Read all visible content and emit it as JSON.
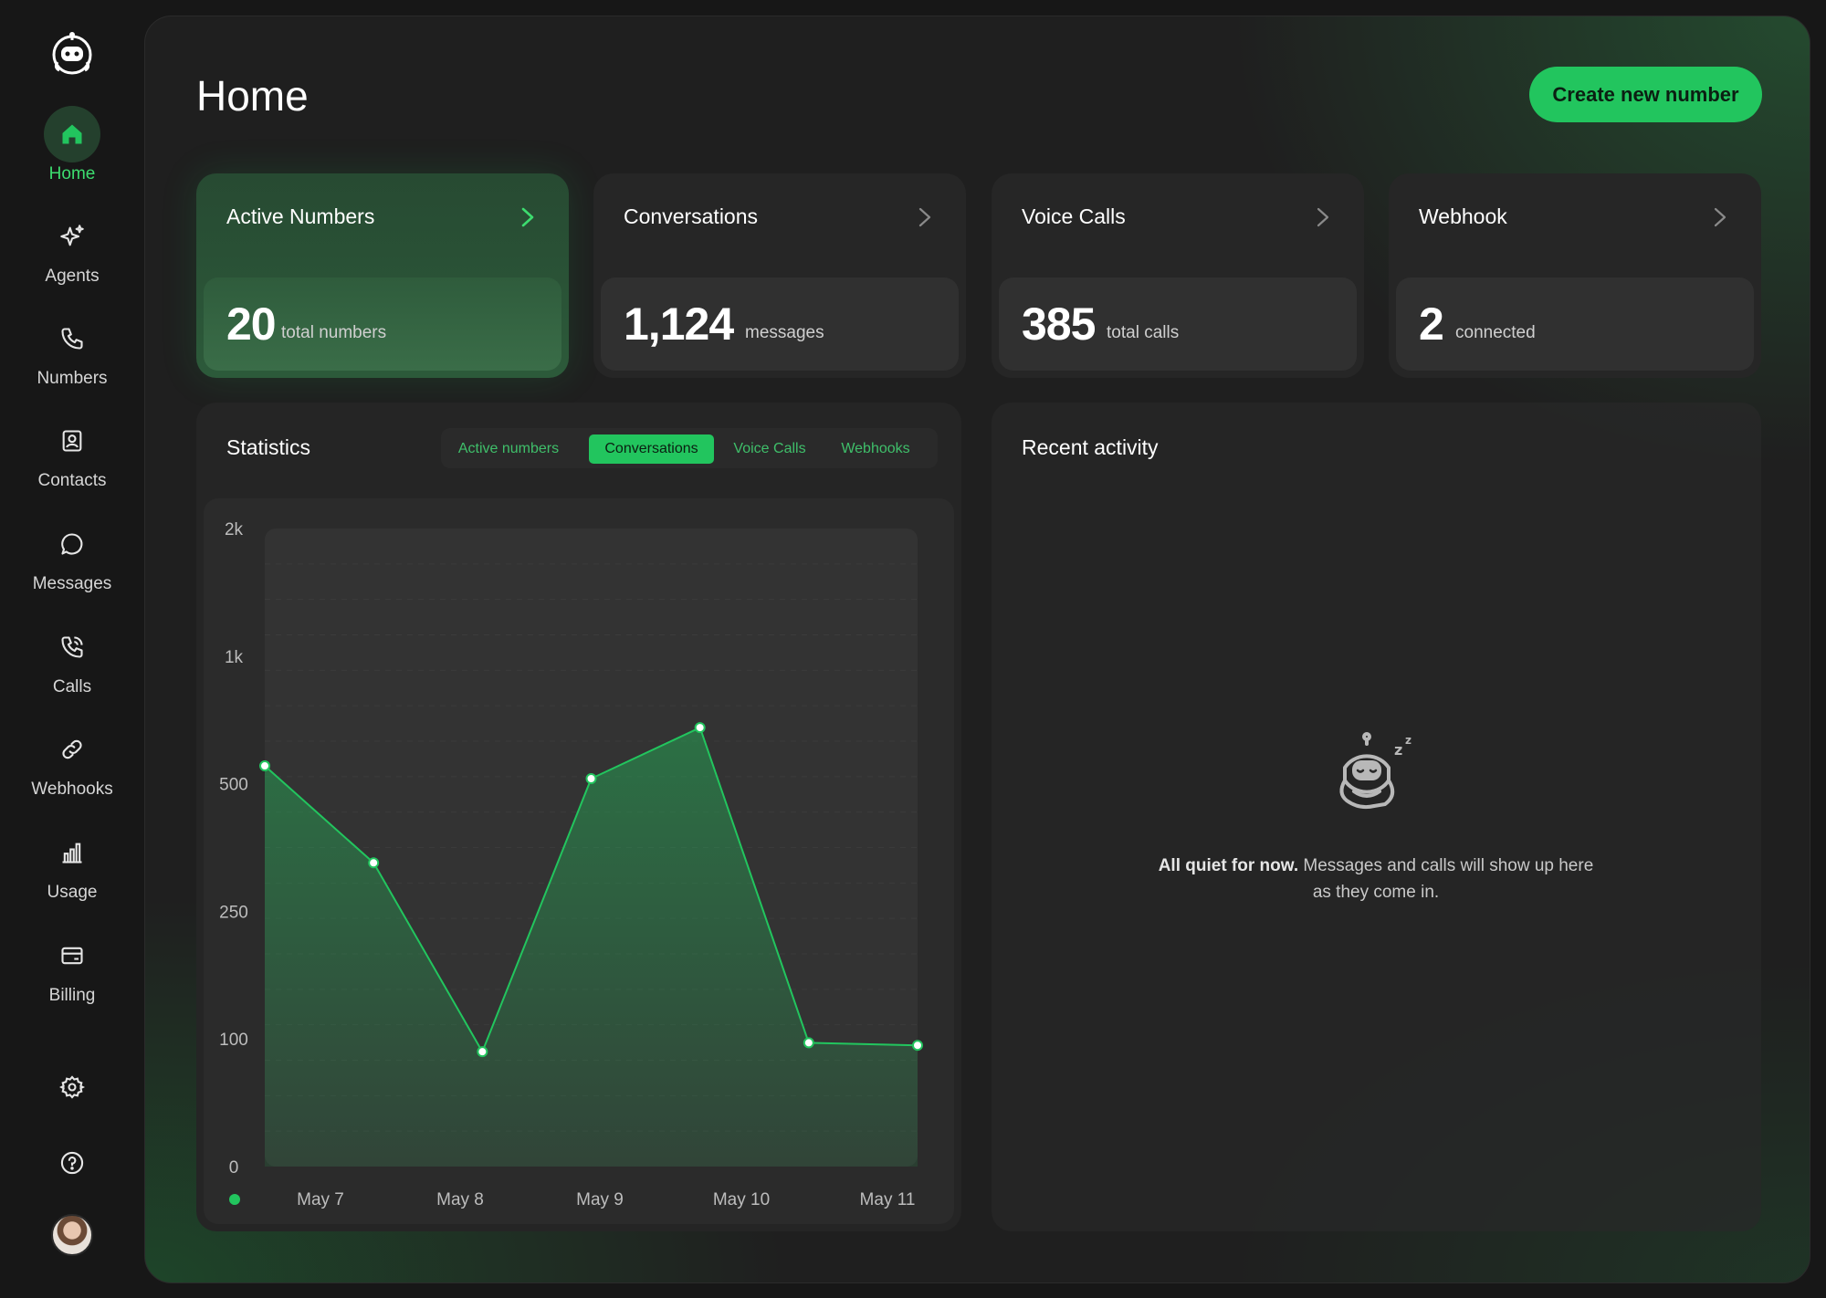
{
  "sidebar": {
    "items": [
      {
        "label": "Home",
        "icon": "home-icon",
        "active": true
      },
      {
        "label": "Agents",
        "icon": "sparkle-icon"
      },
      {
        "label": "Numbers",
        "icon": "phone-icon"
      },
      {
        "label": "Contacts",
        "icon": "contacts-icon"
      },
      {
        "label": "Messages",
        "icon": "message-icon"
      },
      {
        "label": "Calls",
        "icon": "phone-call-icon"
      },
      {
        "label": "Webhooks",
        "icon": "link-icon"
      },
      {
        "label": "Usage",
        "icon": "bar-chart-icon"
      },
      {
        "label": "Billing",
        "icon": "credit-card-icon"
      }
    ],
    "utility": [
      "gear-icon",
      "help-icon"
    ]
  },
  "header": {
    "title": "Home",
    "cta_label": "Create new number"
  },
  "cards": [
    {
      "title": "Active Numbers",
      "value": "20",
      "unit": "total numbers",
      "active": true
    },
    {
      "title": "Conversations",
      "value": "1,124",
      "unit": "messages"
    },
    {
      "title": "Voice Calls",
      "value": "385",
      "unit": "total calls"
    },
    {
      "title": "Webhook",
      "value": "2",
      "unit": "connected"
    }
  ],
  "statistics": {
    "title": "Statistics",
    "tabs": [
      "Active numbers",
      "Conversations",
      "Voice Calls",
      "Webhooks"
    ],
    "active_tab": "Conversations"
  },
  "chart_data": {
    "type": "area",
    "x_ticks": [
      "May 7",
      "May 8",
      "May 9",
      "May 10",
      "May 11"
    ],
    "y_ticks": [
      "0",
      "100",
      "250",
      "500",
      "1k",
      "2k"
    ],
    "points": [
      {
        "x": 0,
        "y": 570
      },
      {
        "x": 1,
        "y": 345
      },
      {
        "x": 2,
        "y": 90
      },
      {
        "x": 3,
        "y": 520
      },
      {
        "x": 4,
        "y": 720
      },
      {
        "x": 5,
        "y": 97
      },
      {
        "x": 6,
        "y": 95
      }
    ],
    "color": "#22c55e",
    "grid": true
  },
  "activity": {
    "title": "Recent activity",
    "empty_bold": "All quiet for now.",
    "empty_text": " Messages and calls will show up here as they come in."
  },
  "colors": {
    "accent": "#22c55e",
    "background": "#171717"
  }
}
